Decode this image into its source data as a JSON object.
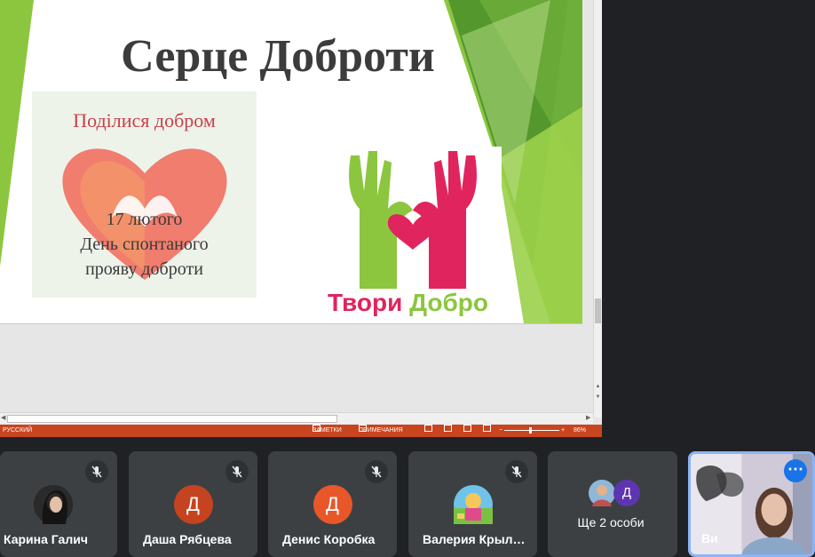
{
  "slide": {
    "title": "Серце Доброти",
    "left_image": {
      "line1": "Поділися добром",
      "line2": "17 лютого",
      "line3": "День спонтаного",
      "line4": "прояву доброти"
    },
    "right_image": {
      "word1": "Твори",
      "word2": "Добро"
    }
  },
  "statusbar": {
    "language": "РУССКИЙ",
    "notes": "ЗАМЕТКИ",
    "comments": "ПРИМЕЧАНИЯ",
    "zoom_minus": "−",
    "zoom_plus": "+",
    "zoom": "86%"
  },
  "participants": [
    {
      "name": "Карина Галич",
      "initial": ""
    },
    {
      "name": "Даша Рябцева",
      "initial": "Д"
    },
    {
      "name": "Денис Коробка",
      "initial": "Д"
    },
    {
      "name": "Валерия Крыл…",
      "initial": ""
    }
  ],
  "more": {
    "label": "Ще 2 особи",
    "initial": "Д"
  },
  "self": {
    "name": "Ви",
    "menu_icon": "⋯"
  },
  "colors": {
    "green_light": "#8cc63f",
    "green_dark": "#4a8f2a",
    "statusbar": "#c8451f",
    "avatar_red": "#c5431e",
    "avatar_orange": "#e8572a",
    "avatar_purple": "#5e35b1",
    "self_border": "#8ab4f8"
  }
}
